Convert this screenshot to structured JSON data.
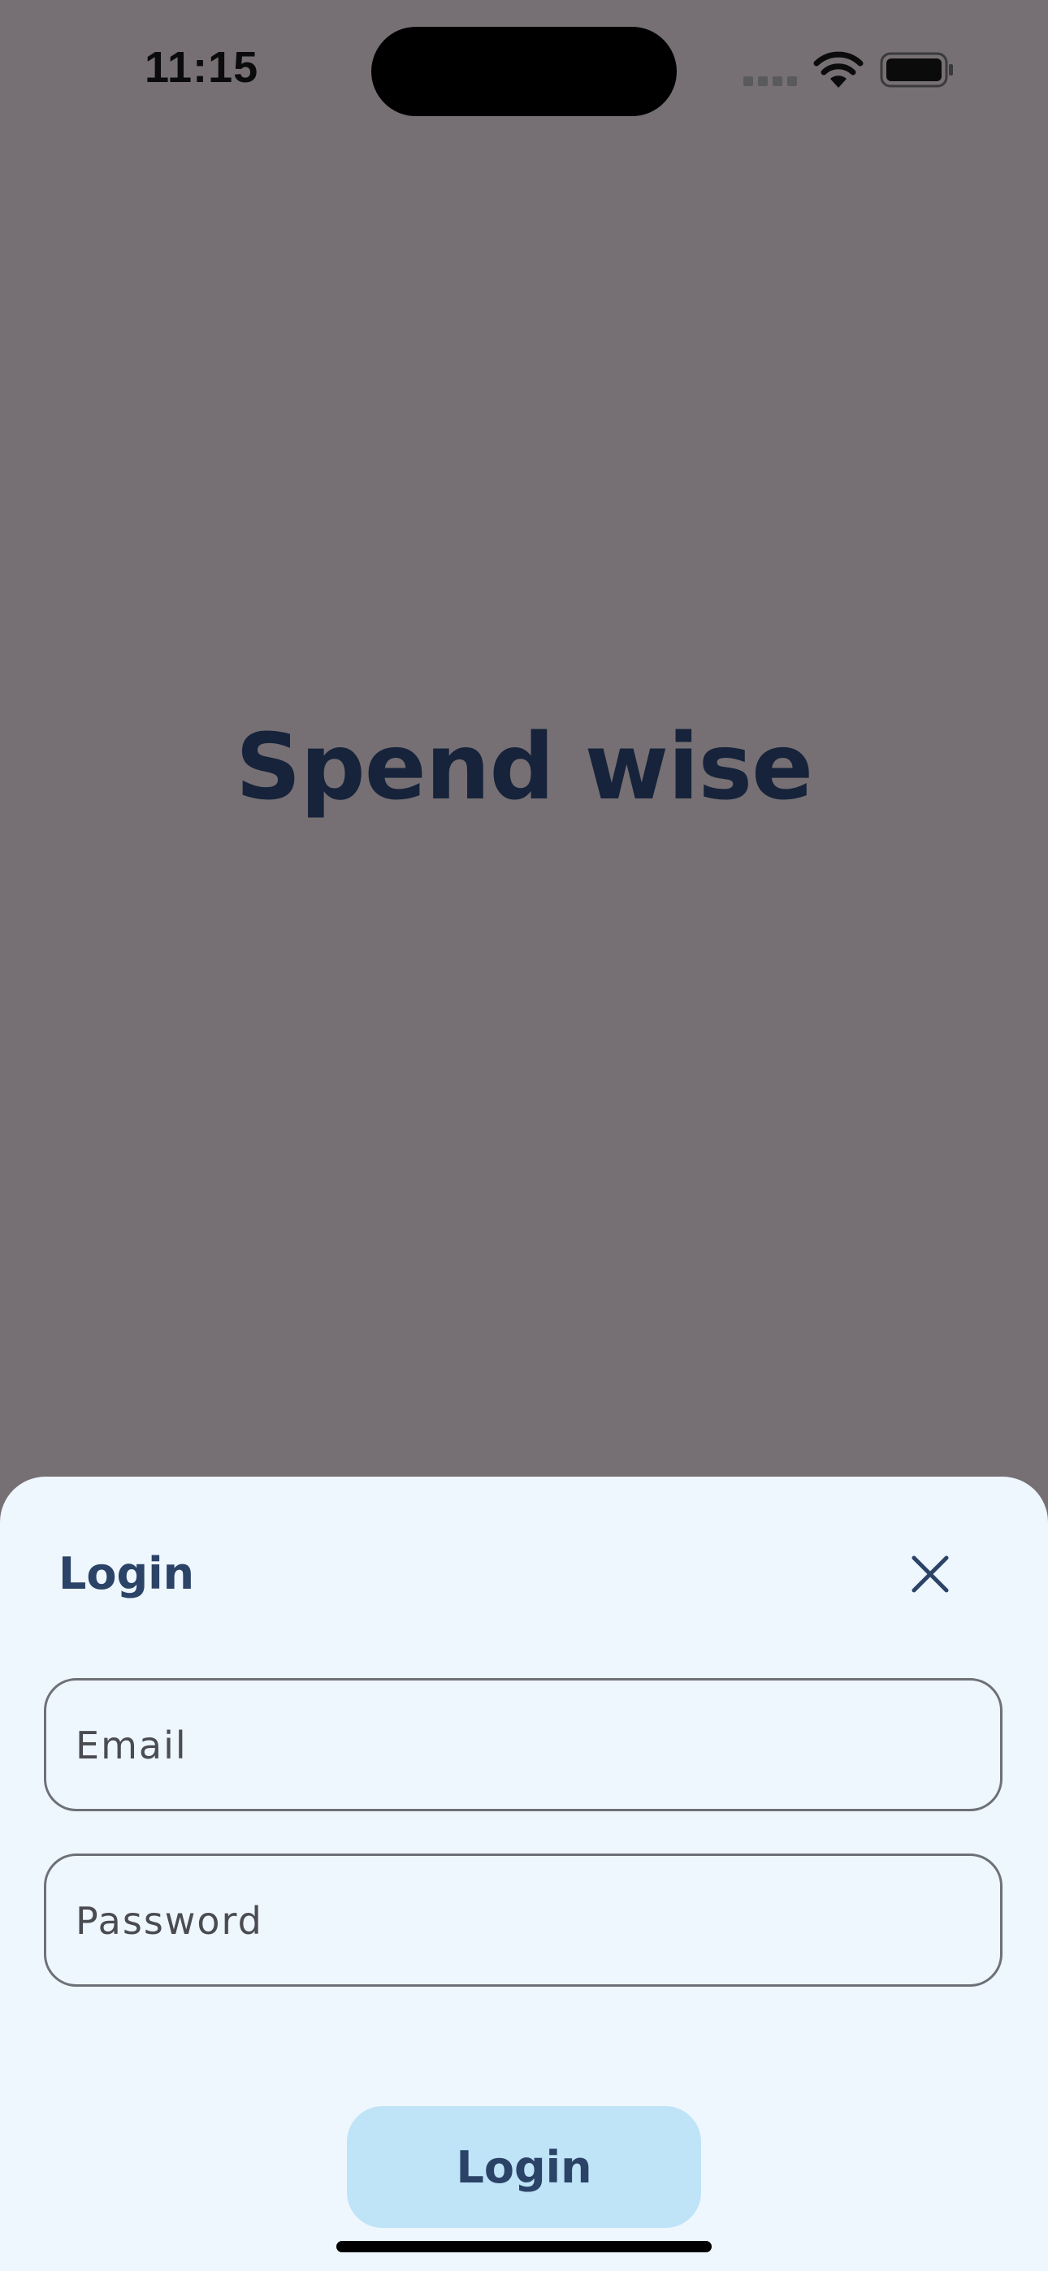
{
  "status_bar": {
    "time": "11:15",
    "icons": [
      "signal-icon",
      "wifi-icon",
      "battery-icon"
    ]
  },
  "background": {
    "headline": "Spend wise",
    "overlay_color": "#767074",
    "headline_color": "#16233a"
  },
  "login_sheet": {
    "title": "Login",
    "close_icon": "close-icon",
    "email": {
      "placeholder": "Email",
      "value": ""
    },
    "password": {
      "placeholder": "Password",
      "value": ""
    },
    "submit_label": "Login",
    "colors": {
      "sheet_background": "#eef6fe",
      "title": "#2a4366",
      "button_background": "#bfe3f7",
      "field_border": "#6e7077"
    }
  }
}
